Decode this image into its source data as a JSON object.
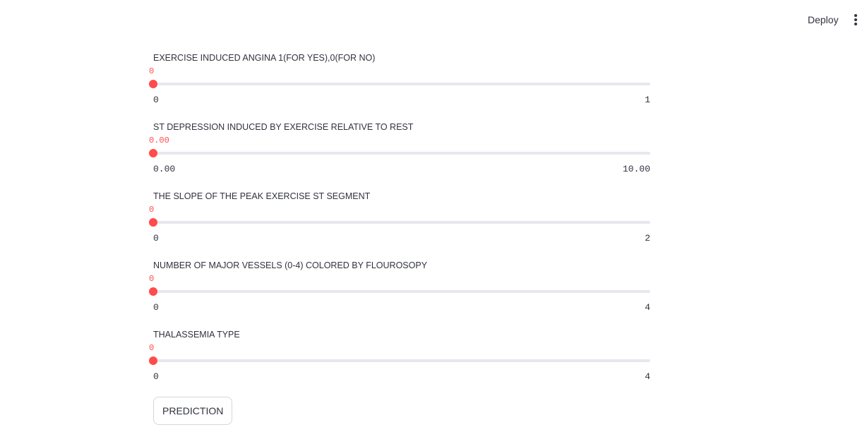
{
  "header": {
    "deploy_label": "Deploy",
    "menu_icon": "vertical-ellipsis-icon"
  },
  "accent_color": "#ff4b4b",
  "sliders": [
    {
      "label": "EXERCISE INDUCED ANGINA 1(FOR YES),0(FOR NO)",
      "value": "0",
      "min": "0",
      "max": "1",
      "fraction": 0
    },
    {
      "label": "ST DEPRESSION INDUCED BY EXERCISE RELATIVE TO REST",
      "value": "0.00",
      "min": "0.00",
      "max": "10.00",
      "fraction": 0
    },
    {
      "label": "THE SLOPE OF THE PEAK EXERCISE ST SEGMENT",
      "value": "0",
      "min": "0",
      "max": "2",
      "fraction": 0
    },
    {
      "label": "NUMBER OF MAJOR VESSELS (0-4) COLORED BY FLOUROSOPY",
      "value": "0",
      "min": "0",
      "max": "4",
      "fraction": 0
    },
    {
      "label": "THALASSEMIA TYPE",
      "value": "0",
      "min": "0",
      "max": "4",
      "fraction": 0
    }
  ],
  "predict_button": {
    "label": "PREDICTION"
  }
}
